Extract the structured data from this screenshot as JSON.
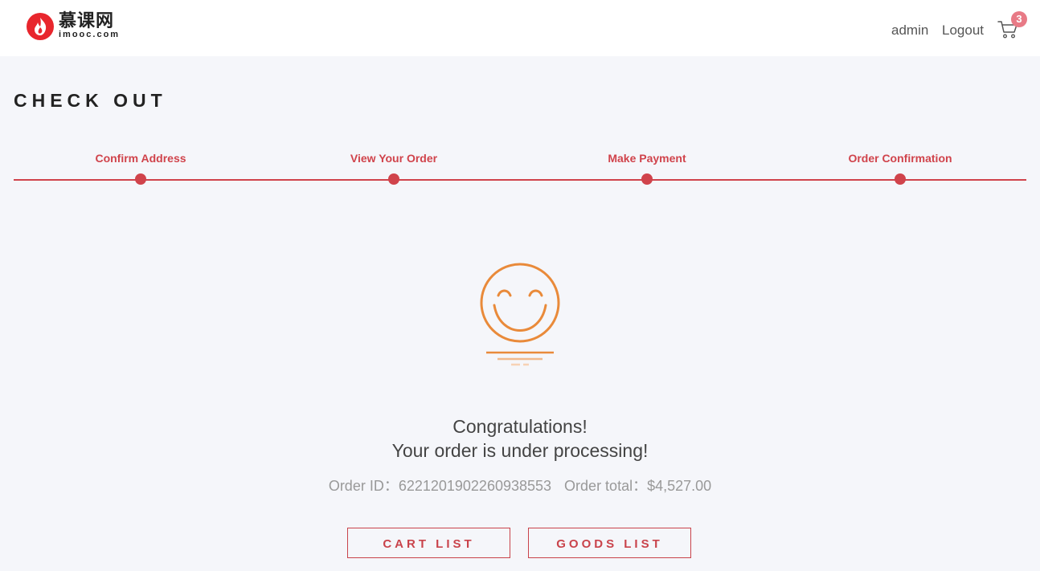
{
  "header": {
    "logo_cn": "慕课网",
    "logo_en": "imooc.com",
    "username": "admin",
    "logout_label": "Logout",
    "cart_count": "3"
  },
  "page": {
    "title": "CHECK OUT"
  },
  "stepper": {
    "steps": [
      {
        "label": "Confirm Address"
      },
      {
        "label": "View Your Order"
      },
      {
        "label": "Make Payment"
      },
      {
        "label": "Order Confirmation"
      }
    ]
  },
  "result": {
    "line1": "Congratulations!",
    "line2": "Your order is under processing!",
    "order_id_label": "Order ID：",
    "order_id": "6221201902260938553",
    "order_total_label": "Order total：",
    "order_total": "$4,527.00"
  },
  "actions": {
    "cart_list": "CART LIST",
    "goods_list": "GOODS LIST"
  },
  "colors": {
    "accent": "#d0434b",
    "smiley": "#e98a3a",
    "badge": "#e87a86",
    "background": "#f5f6fa"
  },
  "icons": {
    "logo": "flame-logo-icon",
    "cart": "shopping-cart-icon",
    "success": "smiley-face-icon"
  }
}
